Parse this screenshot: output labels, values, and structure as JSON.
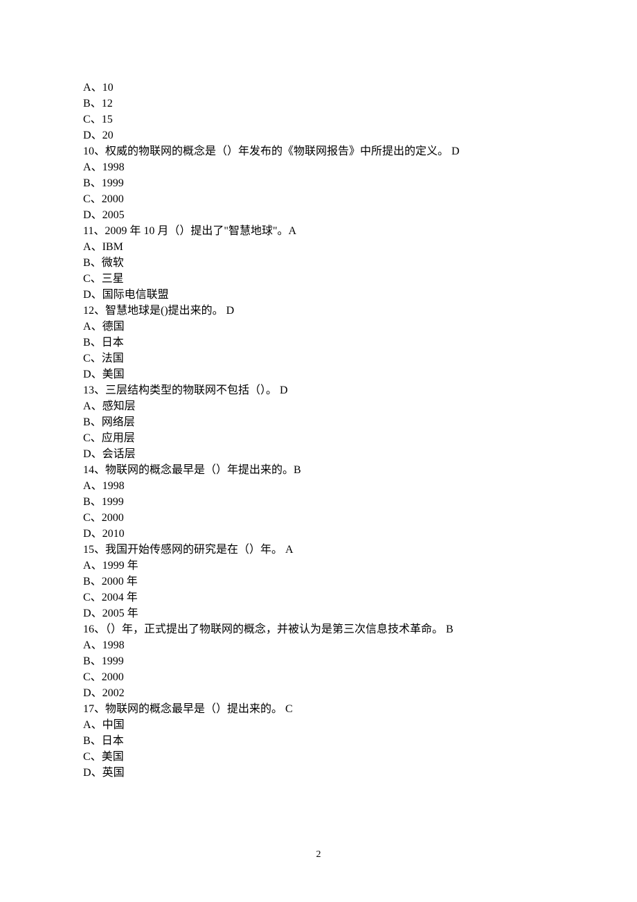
{
  "page_number": "2",
  "questions": [
    {
      "options": [
        {
          "label": "A",
          "text": "10"
        },
        {
          "label": "B",
          "text": "12"
        },
        {
          "label": "C",
          "text": "15"
        },
        {
          "label": "D",
          "text": "20"
        }
      ]
    },
    {
      "stem": "10、权威的物联网的概念是（）年发布的《物联网报告》中所提出的定义。 D",
      "options": [
        {
          "label": "A",
          "text": "1998"
        },
        {
          "label": "B",
          "text": "1999"
        },
        {
          "label": "C",
          "text": "2000"
        },
        {
          "label": "D",
          "text": "2005"
        }
      ]
    },
    {
      "stem": "11、2009 年 10 月（）提出了\"智慧地球\"。A",
      "options": [
        {
          "label": "A",
          "text": "IBM"
        },
        {
          "label": "B",
          "text": "微软"
        },
        {
          "label": "C",
          "text": "三星"
        },
        {
          "label": "D",
          "text": "国际电信联盟"
        }
      ]
    },
    {
      "stem": "12、智慧地球是()提出来的。 D",
      "options": [
        {
          "label": "A",
          "text": "德国"
        },
        {
          "label": "B",
          "text": "日本"
        },
        {
          "label": "C",
          "text": "法国"
        },
        {
          "label": "D",
          "text": "美国"
        }
      ]
    },
    {
      "stem": "13、三层结构类型的物联网不包括（）。 D",
      "options": [
        {
          "label": "A",
          "text": "感知层"
        },
        {
          "label": "B",
          "text": "网络层"
        },
        {
          "label": "C",
          "text": "应用层"
        },
        {
          "label": "D",
          "text": "会话层"
        }
      ]
    },
    {
      "stem": "14、物联网的概念最早是（）年提出来的。B",
      "options": [
        {
          "label": "A",
          "text": "1998"
        },
        {
          "label": "B",
          "text": "1999"
        },
        {
          "label": "C",
          "text": "2000"
        },
        {
          "label": "D",
          "text": "2010"
        }
      ]
    },
    {
      "stem": "15、我国开始传感网的研究是在（）年。 A",
      "options": [
        {
          "label": "A",
          "text": "1999 年"
        },
        {
          "label": "B",
          "text": "2000 年"
        },
        {
          "label": "C",
          "text": "2004 年"
        },
        {
          "label": "D",
          "text": "2005 年"
        }
      ]
    },
    {
      "stem": "16、（）年，正式提出了物联网的概念，并被认为是第三次信息技术革命。 B",
      "options": [
        {
          "label": "A",
          "text": "1998"
        },
        {
          "label": "B",
          "text": "1999"
        },
        {
          "label": "C",
          "text": "2000"
        },
        {
          "label": "D",
          "text": "2002"
        }
      ]
    },
    {
      "stem": "17、物联网的概念最早是（）提出来的。 C",
      "options": [
        {
          "label": "A",
          "text": "中国"
        },
        {
          "label": "B",
          "text": "日本"
        },
        {
          "label": "C",
          "text": "美国"
        },
        {
          "label": "D",
          "text": "英国"
        }
      ]
    }
  ]
}
